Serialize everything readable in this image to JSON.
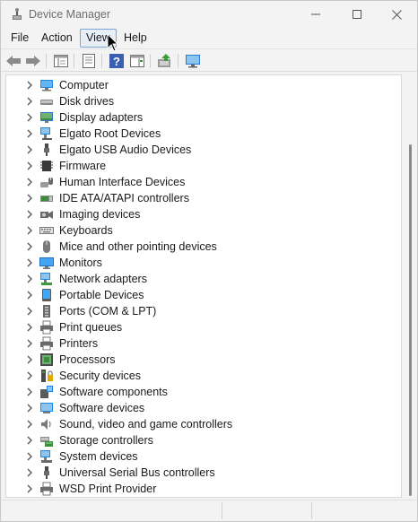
{
  "window": {
    "title": "Device Manager"
  },
  "menu": {
    "file": "File",
    "action": "Action",
    "view": "View",
    "help": "Help"
  },
  "toolbar": {
    "buttons": [
      "back-arrow-icon",
      "forward-arrow-icon",
      "show-hide-console-tree-icon",
      "properties-icon",
      "help-icon",
      "action-pane-icon",
      "update-driver-icon",
      "scan-hardware-changes-icon"
    ]
  },
  "tree": {
    "categories": [
      {
        "label": "Computer",
        "icon": "computer-icon"
      },
      {
        "label": "Disk drives",
        "icon": "disk-drive-icon"
      },
      {
        "label": "Display adapters",
        "icon": "display-adapter-icon"
      },
      {
        "label": "Elgato Root Devices",
        "icon": "network-device-icon"
      },
      {
        "label": "Elgato USB Audio Devices",
        "icon": "usb-audio-icon"
      },
      {
        "label": "Firmware",
        "icon": "firmware-chip-icon"
      },
      {
        "label": "Human Interface Devices",
        "icon": "hid-icon"
      },
      {
        "label": "IDE ATA/ATAPI controllers",
        "icon": "ide-controller-icon"
      },
      {
        "label": "Imaging devices",
        "icon": "camera-icon"
      },
      {
        "label": "Keyboards",
        "icon": "keyboard-icon"
      },
      {
        "label": "Mice and other pointing devices",
        "icon": "mouse-icon"
      },
      {
        "label": "Monitors",
        "icon": "monitor-icon"
      },
      {
        "label": "Network adapters",
        "icon": "network-adapter-icon"
      },
      {
        "label": "Portable Devices",
        "icon": "portable-device-icon"
      },
      {
        "label": "Ports (COM & LPT)",
        "icon": "port-icon"
      },
      {
        "label": "Print queues",
        "icon": "printer-icon"
      },
      {
        "label": "Printers",
        "icon": "printer-icon"
      },
      {
        "label": "Processors",
        "icon": "processor-icon"
      },
      {
        "label": "Security devices",
        "icon": "security-device-icon"
      },
      {
        "label": "Software components",
        "icon": "software-component-icon"
      },
      {
        "label": "Software devices",
        "icon": "software-device-icon"
      },
      {
        "label": "Sound, video and game controllers",
        "icon": "speaker-icon"
      },
      {
        "label": "Storage controllers",
        "icon": "storage-controller-icon"
      },
      {
        "label": "System devices",
        "icon": "system-device-icon"
      },
      {
        "label": "Universal Serial Bus controllers",
        "icon": "usb-icon"
      },
      {
        "label": "WSD Print Provider",
        "icon": "printer-icon"
      }
    ]
  },
  "colors": {
    "accent_blue": "#1e88e5",
    "menu_highlight": "#e8eef8",
    "menu_highlight_border": "#7aa5d6"
  }
}
